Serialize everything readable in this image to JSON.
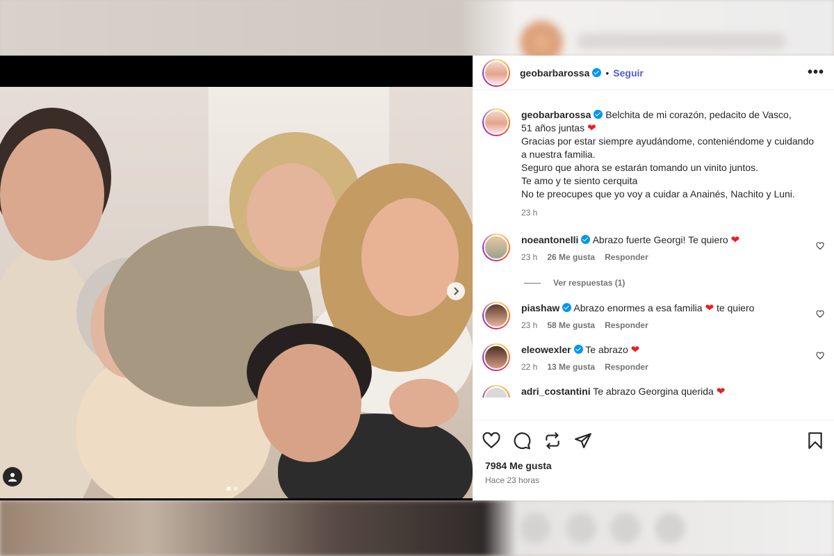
{
  "post": {
    "username": "geobarbarossa",
    "follow_label": "Seguir",
    "separator": "•",
    "more_label": "•••",
    "caption": {
      "lines": [
        "Belchita de mi corazón, pedacito de Vasco,",
        "51 años juntas",
        "Gracias por estar siempre ayudándome, conteniéndome y cuidando",
        "a nuestra familia.",
        "Seguro que ahora se estarán tomando un vinito juntos.",
        "Te amo y te siento cerquita",
        "No te preocupes que yo voy a cuidar a Anainés, Nachito y Luni."
      ],
      "time": "23 h"
    },
    "comments": [
      {
        "username": "noeantonelli",
        "text": "Abrazo fuerte Georgi! Te quiero",
        "time": "23 h",
        "likes": "26 Me gusta",
        "reply": "Responder"
      },
      {
        "username": "piashaw",
        "text": "Abrazo enormes a esa familia",
        "text_after": "te quiero",
        "time": "23 h",
        "likes": "58 Me gusta",
        "reply": "Responder"
      },
      {
        "username": "eleowexler",
        "text": "Te abrazo",
        "time": "22 h",
        "likes": "13 Me gusta",
        "reply": "Responder"
      },
      {
        "username": "adri_costantini",
        "text": "Te abrazo Georgina querida"
      }
    ],
    "view_replies": "Ver respuestas (1)",
    "likes_count": "7984 Me gusta",
    "time_ago": "Hace 23 horas"
  },
  "carousel": {
    "current": 1,
    "total": 2
  },
  "colors": {
    "follow": "#4f5bd5",
    "verified": "#0095f6",
    "heart": "#ed1c24"
  },
  "icons": [
    "heart-icon",
    "comment-icon",
    "repost-icon",
    "share-icon",
    "save-icon",
    "user-tag-icon",
    "next-arrow-icon"
  ]
}
